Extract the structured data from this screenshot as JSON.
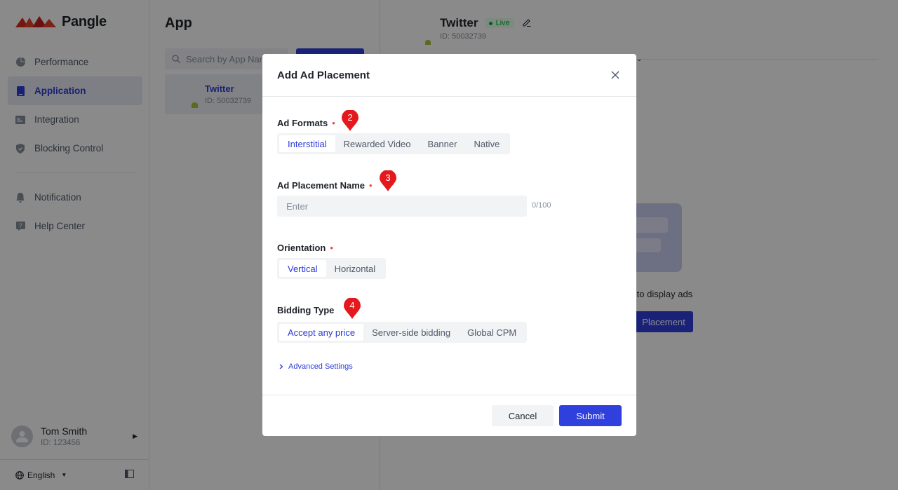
{
  "brand": {
    "name": "Pangle"
  },
  "sidebar": {
    "items": [
      {
        "label": "Performance",
        "icon": "pie-chart-icon",
        "active": false
      },
      {
        "label": "Application",
        "icon": "app-icon",
        "active": true
      },
      {
        "label": "Integration",
        "icon": "integration-icon",
        "active": false
      },
      {
        "label": "Blocking Control",
        "icon": "shield-icon",
        "active": false
      },
      {
        "label": "Notification",
        "icon": "bell-icon",
        "active": false
      },
      {
        "label": "Help Center",
        "icon": "help-icon",
        "active": false
      }
    ],
    "user": {
      "name": "Tom Smith",
      "id": "ID: 123456"
    },
    "language": "English"
  },
  "app_panel": {
    "title": "App",
    "search_placeholder": "Search by App Name",
    "apps": [
      {
        "name": "Twitter",
        "id": "ID: 50032739",
        "platform": "android-icon"
      }
    ]
  },
  "detail": {
    "title": "Twitter",
    "status": "Live",
    "id": "ID: 50032739",
    "empty_hint": "ent to display ads",
    "button_label": "Placement"
  },
  "modal": {
    "title": "Add Ad Placement",
    "ad_formats": {
      "label": "Ad Formats",
      "options": [
        "Interstitial",
        "Rewarded Video",
        "Banner",
        "Native"
      ],
      "selected": "Interstitial",
      "marker": "2"
    },
    "placement_name": {
      "label": "Ad Placement Name",
      "placeholder": "Enter",
      "value": "",
      "counter": "0/100",
      "marker": "3"
    },
    "orientation": {
      "label": "Orientation",
      "options": [
        "Vertical",
        "Horizontal"
      ],
      "selected": "Vertical"
    },
    "bidding_type": {
      "label": "Bidding Type",
      "options": [
        "Accept any price",
        "Server-side bidding",
        "Global CPM"
      ],
      "selected": "Accept any price",
      "marker": "4"
    },
    "advanced_settings": "Advanced Settings",
    "cancel": "Cancel",
    "submit": "Submit"
  },
  "colors": {
    "accent": "#2f40dd",
    "required": "#f53f3f",
    "marker": "#e5181e",
    "live": "#00b42a"
  }
}
